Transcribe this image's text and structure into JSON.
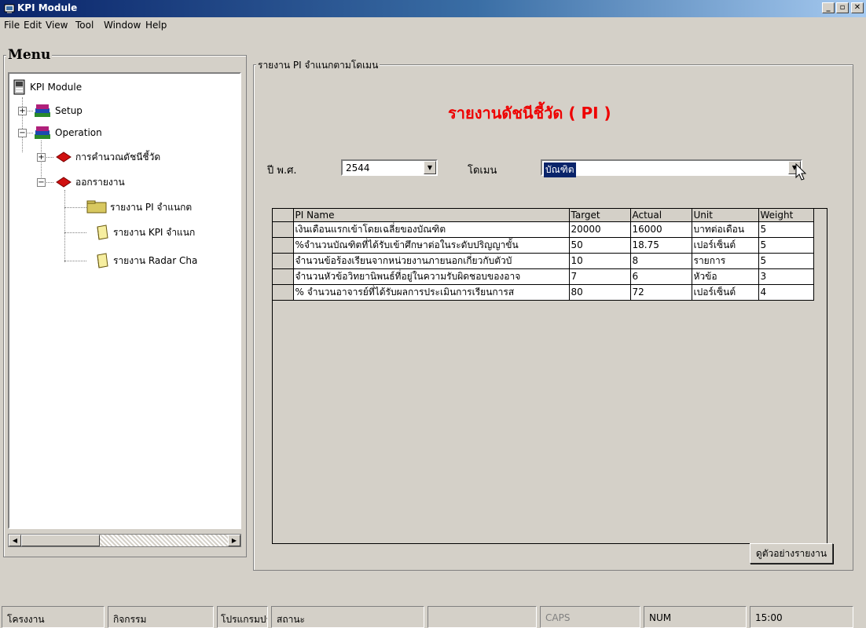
{
  "window": {
    "title": "KPI Module",
    "minimize": "_",
    "restore": "▫",
    "close": "✕"
  },
  "menubar": [
    "File",
    "Edit",
    "View",
    "Tool",
    "Window",
    "Help"
  ],
  "menu_panel": {
    "title": "Menu",
    "tree": [
      {
        "label": "KPI Module",
        "icon": "kpi-module-icon"
      },
      {
        "label": "Setup",
        "icon": "books-icon",
        "toggle": "+"
      },
      {
        "label": "Operation",
        "icon": "books-icon",
        "toggle": "−"
      },
      {
        "label": "การคำนวณดัชนีชี้วัด",
        "icon": "red-book-icon",
        "toggle": "+"
      },
      {
        "label": "ออกรายงาน",
        "icon": "red-book-icon",
        "toggle": "−"
      },
      {
        "label": "รายงาน PI จำแนกต",
        "icon": "folder-icon"
      },
      {
        "label": "รายงาน KPI จำแนก",
        "icon": "folder-icon"
      },
      {
        "label": "รายงาน Radar Cha",
        "icon": "folder-icon"
      }
    ]
  },
  "report_panel": {
    "title": "รายงาน PI จำแนกตามโดเมน",
    "heading": "รายงานดัชนีชี้วัด ( PI )",
    "year_label": "ปี พ.ศ.",
    "year_value": "2544",
    "domain_label": "โดเมน",
    "domain_value": "บัณฑิต",
    "preview_button": "ดูตัวอย่างรายงาน"
  },
  "table": {
    "columns": [
      "PI Name",
      "Target",
      "Actual",
      "Unit",
      "Weight"
    ],
    "rows": [
      [
        "เงินเดือนแรกเข้าโดยเฉลี่ยของบัณฑิต",
        "20000",
        "16000",
        "บาทต่อเดือน",
        "5"
      ],
      [
        "%จำนวนบัณฑิตที่ได้รับเข้าศึกษาต่อในระดับปริญญาขั้น",
        "50",
        "18.75",
        "เปอร์เซ็นต์",
        "5"
      ],
      [
        "จำนวนข้อร้องเรียนจากหน่วยงานภายนอกเกี่ยวกับตัวบั",
        "10",
        "8",
        "รายการ",
        "5"
      ],
      [
        "จำนวนหัวข้อวิทยานิพนธ์ที่อยู่ในความรับผิดชอบของอาจ",
        "7",
        "6",
        "หัวข้อ",
        "3"
      ],
      [
        "% จำนวนอาจารย์ที่ได้รับผลการประเมินการเรียนการส",
        "80",
        "72",
        "เปอร์เซ็นต์",
        "4"
      ]
    ]
  },
  "statusbar": [
    "โครงงาน",
    "กิจกรรม",
    "โปรแกรมประเภท",
    "สถานะ",
    "",
    "CAPS",
    "NUM",
    "15:00"
  ]
}
